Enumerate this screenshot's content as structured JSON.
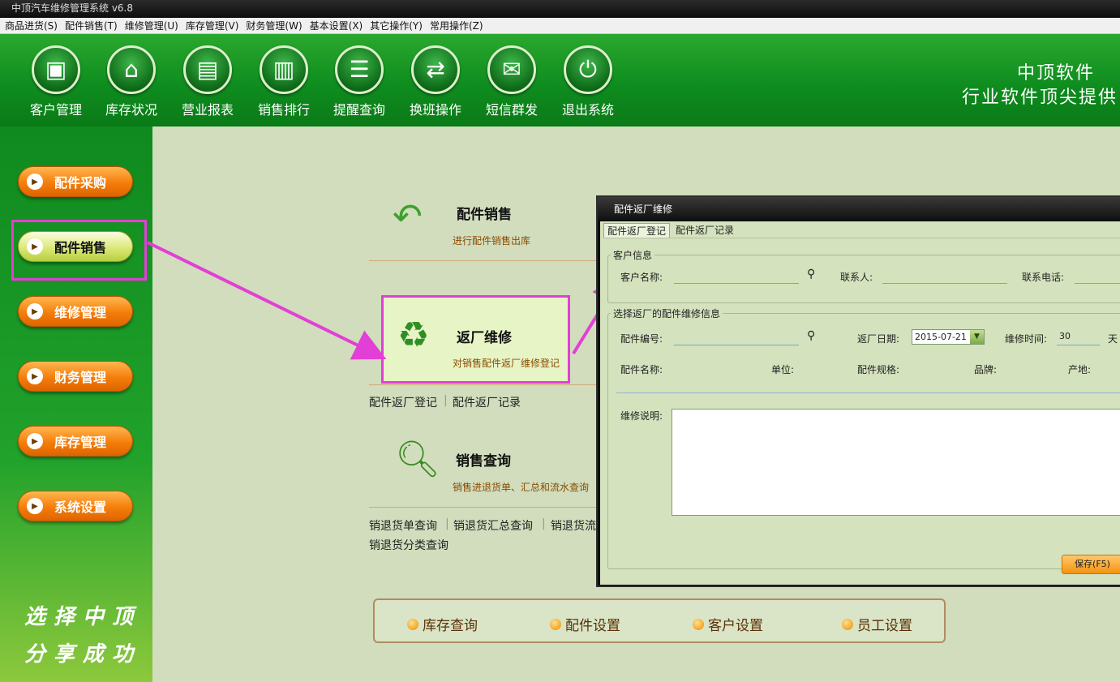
{
  "window": {
    "title": "中顶汽车维修管理系统 v6.8"
  },
  "menu": [
    "商品进货(S)",
    "配件销售(T)",
    "维修管理(U)",
    "库存管理(V)",
    "财务管理(W)",
    "基本设置(X)",
    "其它操作(Y)",
    "常用操作(Z)"
  ],
  "toolbar": {
    "items": [
      {
        "label": "客户管理",
        "icon": "customer-card-icon"
      },
      {
        "label": "库存状况",
        "icon": "home-icon"
      },
      {
        "label": "营业报表",
        "icon": "document-icon"
      },
      {
        "label": "销售排行",
        "icon": "bar-chart-icon"
      },
      {
        "label": "提醒查询",
        "icon": "message-icon"
      },
      {
        "label": "换班操作",
        "icon": "swap-arrows-icon"
      },
      {
        "label": "短信群发",
        "icon": "envelope-icon"
      },
      {
        "label": "退出系统",
        "icon": "power-icon"
      }
    ],
    "brand_line1": "中顶软件",
    "brand_line2": "行业软件顶尖提供"
  },
  "sidebar": {
    "items": [
      "配件采购",
      "配件销售",
      "维修管理",
      "财务管理",
      "库存管理",
      "系统设置"
    ],
    "active": "配件销售",
    "slogan1": "选择中顶",
    "slogan2": "分享成功"
  },
  "main": {
    "sales": {
      "title": "配件销售",
      "subtitle": "进行配件销售出库"
    },
    "return": {
      "title": "返厂维修",
      "subtitle": "对销售配件返厂维修登记",
      "links": [
        "配件返厂登记",
        "配件返厂记录"
      ]
    },
    "query": {
      "title": "销售查询",
      "subtitle": "销售进退货单、汇总和流水查询",
      "links": [
        "销退货单查询",
        "销退货汇总查询",
        "销退货流"
      ],
      "links2": [
        "销退货分类查询"
      ]
    }
  },
  "bottom": {
    "items": [
      "库存查询",
      "配件设置",
      "客户设置",
      "员工设置"
    ]
  },
  "dialog": {
    "title": "配件返厂维修",
    "tabs": [
      "配件返厂登记",
      "配件返厂记录"
    ],
    "customer_group": "客户信息",
    "customer_name_label": "客户名称:",
    "contact_label": "联系人:",
    "phone_label": "联系电话:",
    "repair_group": "选择返厂的配件维修信息",
    "part_no_label": "配件编号:",
    "return_date_label": "返厂日期:",
    "return_date_value": "2015-07-21",
    "repair_time_label": "维修时间:",
    "repair_time_value": "30",
    "repair_time_unit": "天",
    "part_name_label": "配件名称:",
    "unit_label": "单位:",
    "spec_label": "配件规格:",
    "brand_label": "品牌:",
    "origin_label": "产地:",
    "note_label": "维修说明:",
    "save_label": "保存(F5)"
  }
}
